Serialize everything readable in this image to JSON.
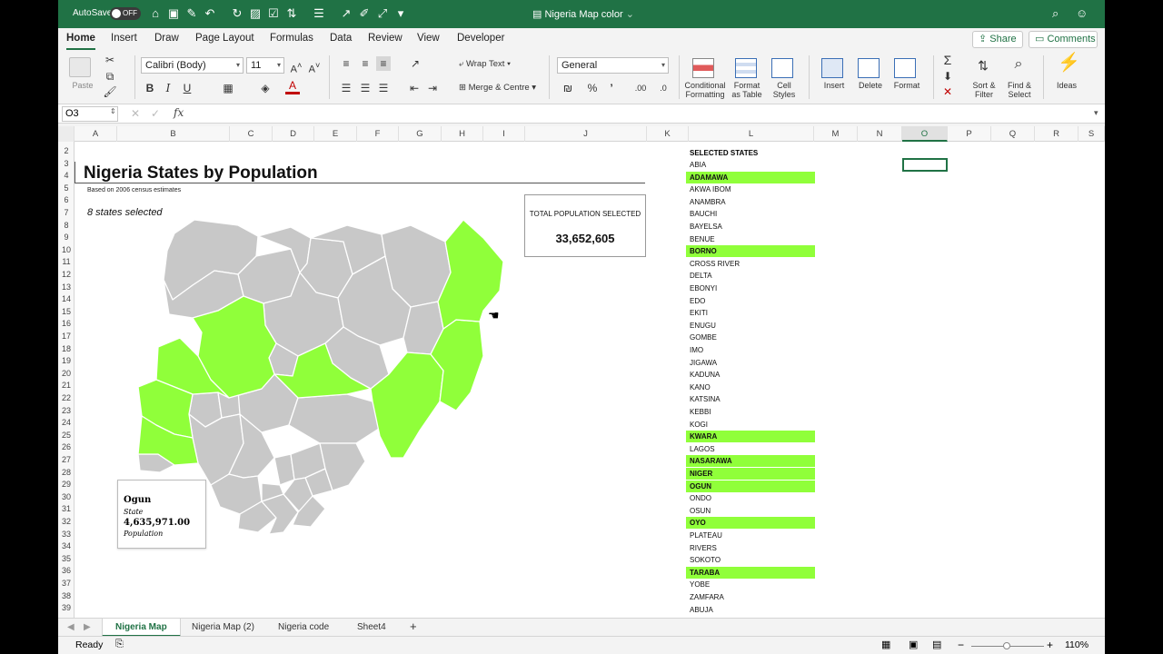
{
  "titlebar": {
    "autosave_label": "AutoSave",
    "autosave_state": "OFF",
    "doc_title": "Nigeria Map color"
  },
  "ribbon_tabs": [
    "Home",
    "Insert",
    "Draw",
    "Page Layout",
    "Formulas",
    "Data",
    "Review",
    "View",
    "Developer"
  ],
  "share_label": "Share",
  "comments_label": "Comments",
  "ribbon": {
    "paste": "Paste",
    "font_name": "Calibri (Body)",
    "font_size": "11",
    "bold": "B",
    "italic": "I",
    "underline": "U",
    "wrap_text": "Wrap Text",
    "merge_center": "Merge & Centre",
    "number_format": "General",
    "conditional_formatting": [
      "Conditional",
      "Formatting"
    ],
    "format_as_table": [
      "Format",
      "as Table"
    ],
    "cell_styles": [
      "Cell",
      "Styles"
    ],
    "insert": "Insert",
    "delete": "Delete",
    "format": "Format",
    "sort_filter": [
      "Sort &",
      "Filter"
    ],
    "find_select": [
      "Find &",
      "Select"
    ],
    "ideas": "Ideas"
  },
  "formula_bar": {
    "name_box": "O3",
    "fx": "fx",
    "formula": ""
  },
  "columns": [
    "A",
    "B",
    "C",
    "D",
    "E",
    "F",
    "G",
    "H",
    "I",
    "J",
    "K",
    "L",
    "M",
    "N",
    "O",
    "P",
    "Q",
    "R",
    "S"
  ],
  "selected_column": "O",
  "rows": [
    "2",
    "3",
    "4",
    "5",
    "6",
    "7",
    "8",
    "9",
    "10",
    "11",
    "12",
    "13",
    "14",
    "15",
    "16",
    "17",
    "18",
    "19",
    "20",
    "21",
    "22",
    "23",
    "24",
    "25",
    "26",
    "27",
    "28",
    "29",
    "30",
    "31",
    "32",
    "33",
    "34",
    "35",
    "36",
    "37",
    "38",
    "39"
  ],
  "report": {
    "title": "Nigeria States by Population",
    "subtitle": "Based on 2006 census estimates",
    "count_text": "8 states selected",
    "total_label": "TOTAL POPULATION SELECTED",
    "total_value": "33,652,605"
  },
  "tooltip": {
    "name": "Ogun",
    "name_label": "State",
    "value": "4,635,971.00",
    "value_label": "Population"
  },
  "state_list": {
    "header": "SELECTED STATES",
    "items": [
      {
        "name": "ABIA",
        "selected": false
      },
      {
        "name": "ADAMAWA",
        "selected": true
      },
      {
        "name": "AKWA IBOM",
        "selected": false
      },
      {
        "name": "ANAMBRA",
        "selected": false
      },
      {
        "name": "BAUCHI",
        "selected": false
      },
      {
        "name": "BAYELSA",
        "selected": false
      },
      {
        "name": "BENUE",
        "selected": false
      },
      {
        "name": "BORNO",
        "selected": true
      },
      {
        "name": "CROSS RIVER",
        "selected": false
      },
      {
        "name": "DELTA",
        "selected": false
      },
      {
        "name": "EBONYI",
        "selected": false
      },
      {
        "name": "EDO",
        "selected": false
      },
      {
        "name": "EKITI",
        "selected": false
      },
      {
        "name": "ENUGU",
        "selected": false
      },
      {
        "name": "GOMBE",
        "selected": false
      },
      {
        "name": "IMO",
        "selected": false
      },
      {
        "name": "JIGAWA",
        "selected": false
      },
      {
        "name": "KADUNA",
        "selected": false
      },
      {
        "name": "KANO",
        "selected": false
      },
      {
        "name": "KATSINA",
        "selected": false
      },
      {
        "name": "KEBBI",
        "selected": false
      },
      {
        "name": "KOGI",
        "selected": false
      },
      {
        "name": "KWARA",
        "selected": true
      },
      {
        "name": "LAGOS",
        "selected": false
      },
      {
        "name": "NASARAWA",
        "selected": true
      },
      {
        "name": "NIGER",
        "selected": true
      },
      {
        "name": "OGUN",
        "selected": true
      },
      {
        "name": "ONDO",
        "selected": false
      },
      {
        "name": "OSUN",
        "selected": false
      },
      {
        "name": "OYO",
        "selected": true
      },
      {
        "name": "PLATEAU",
        "selected": false
      },
      {
        "name": "RIVERS",
        "selected": false
      },
      {
        "name": "SOKOTO",
        "selected": false
      },
      {
        "name": "TARABA",
        "selected": true
      },
      {
        "name": "YOBE",
        "selected": false
      },
      {
        "name": "ZAMFARA",
        "selected": false
      },
      {
        "name": "ABUJA",
        "selected": false
      }
    ]
  },
  "sheet_tabs": [
    "Nigeria Map",
    "Nigeria Map (2)",
    "Nigeria code",
    "Sheet4"
  ],
  "active_sheet": "Nigeria Map",
  "status": {
    "ready": "Ready",
    "zoom": "110%"
  },
  "colors": {
    "excel_green": "#207245",
    "selected_fill": "#90ff3a",
    "unselected_fill": "#c8c8c8"
  }
}
